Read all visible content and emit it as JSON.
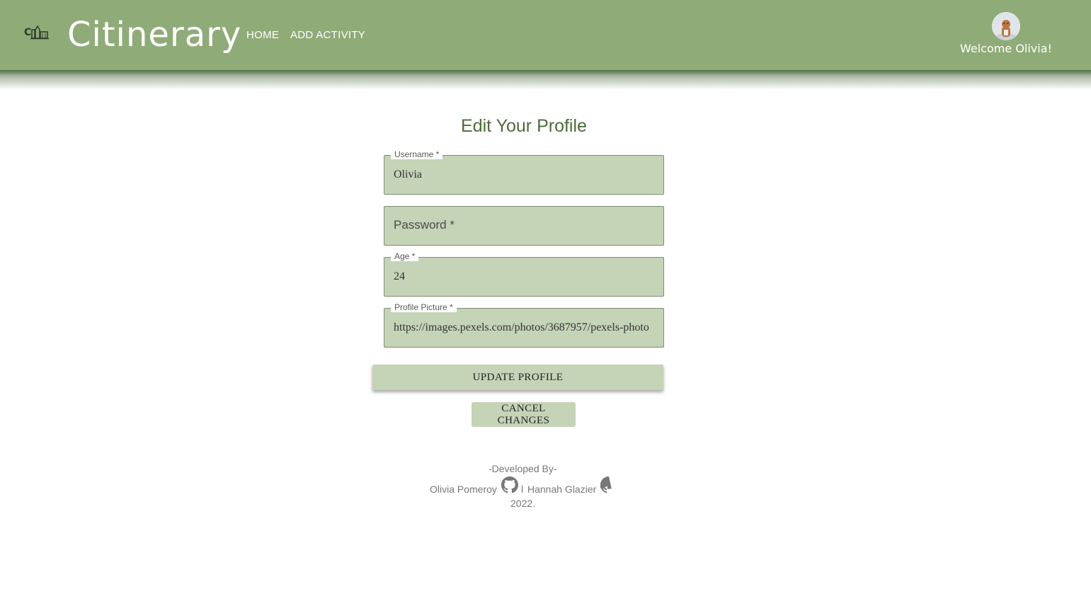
{
  "header": {
    "brand": "Citinerary",
    "nav": [
      {
        "label": "HOME"
      },
      {
        "label": "ADD ACTIVITY"
      }
    ],
    "welcome": "Welcome Olivia!"
  },
  "form": {
    "title": "Edit Your Profile",
    "fields": [
      {
        "label": "Username *",
        "value": "Olivia"
      },
      {
        "label": "Password *",
        "value": ""
      },
      {
        "label": "Age *",
        "value": "24"
      },
      {
        "label": "Profile Picture *",
        "value": "https://images.pexels.com/photos/3687957/pexels-photo"
      }
    ],
    "update_label": "UPDATE PROFILE",
    "cancel_label": "CANCEL CHANGES"
  },
  "footer": {
    "developed_by": "-Developed By-",
    "dev1": "Olivia Pomeroy",
    "separator": "l",
    "dev2": "Hannah Glazier",
    "year": "2022."
  },
  "colors": {
    "header_bg": "#8fab78",
    "field_bg": "#c5d3b7",
    "title_color": "#4d6b3b"
  },
  "icons": [
    "city-logo-icon",
    "github-icon"
  ]
}
